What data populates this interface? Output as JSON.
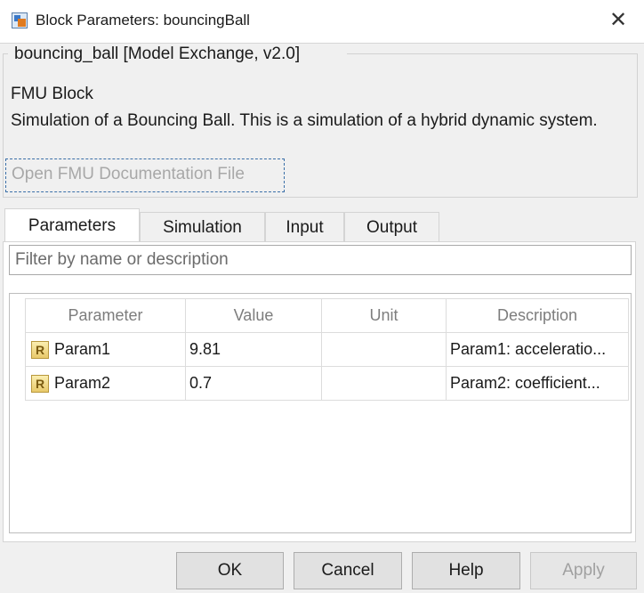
{
  "window": {
    "title": "Block Parameters: bouncingBall",
    "close_glyph": "✕",
    "icon": "simulink-block-icon"
  },
  "block": {
    "group_title": "bouncing_ball [Model Exchange, v2.0]",
    "type_label": "FMU Block",
    "description": "Simulation of a Bouncing Ball. This is a simulation of a hybrid dynamic system.",
    "doc_link": "Open FMU Documentation File"
  },
  "tabs": [
    {
      "label": "Parameters",
      "active": true
    },
    {
      "label": "Simulation",
      "active": false
    },
    {
      "label": "Input",
      "active": false
    },
    {
      "label": "Output",
      "active": false
    }
  ],
  "filter": {
    "placeholder": "Filter by name or description",
    "value": ""
  },
  "table": {
    "headers": [
      "Parameter",
      "Value",
      "Unit",
      "Description"
    ],
    "rows": [
      {
        "icon": "R",
        "parameter": "Param1",
        "value": "9.81",
        "unit": "",
        "description": "Param1: acceleratio..."
      },
      {
        "icon": "R",
        "parameter": "Param2",
        "value": "0.7",
        "unit": "",
        "description": "Param2: coefficient..."
      }
    ]
  },
  "buttons": {
    "ok": "OK",
    "cancel": "Cancel",
    "help": "Help",
    "apply": "Apply"
  },
  "colors": {
    "background": "#f0f0f0",
    "link_focus_border": "#3a6fa8",
    "disabled_text": "#a0a0a0"
  }
}
